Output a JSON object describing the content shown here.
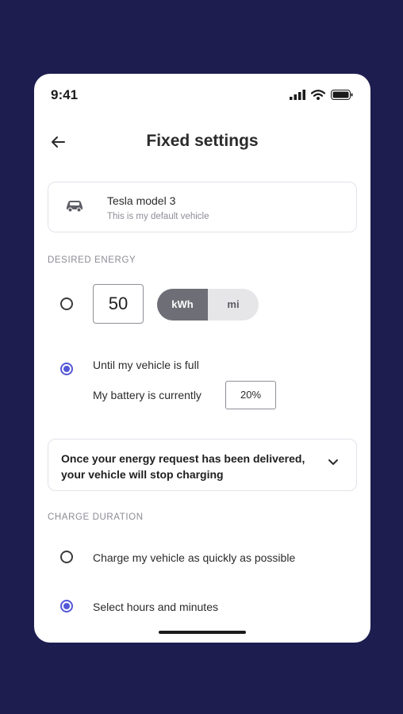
{
  "status_bar": {
    "time": "9:41",
    "icons": [
      "signal-icon",
      "wifi-icon",
      "battery-icon"
    ]
  },
  "header": {
    "title": "Fixed settings",
    "back_icon": "arrow-left-icon"
  },
  "vehicle": {
    "name": "Tesla model 3",
    "subtitle": "This is my default vehicle",
    "icon": "car-icon"
  },
  "desired_energy": {
    "section_label": "DESIRED ENERGY",
    "amount_option": {
      "selected": false,
      "value": "50",
      "units": [
        "kWh",
        "mi"
      ],
      "selected_unit": "kWh"
    },
    "full_option": {
      "selected": true,
      "label": "Until my vehicle is full",
      "battery_label": "My battery is currently",
      "battery_value": "20%"
    }
  },
  "info": {
    "text": "Once your energy request has been delivered, your vehicle will stop charging",
    "icon": "chevron-down-icon"
  },
  "charge_duration": {
    "section_label": "CHARGE DURATION",
    "options": [
      {
        "label": "Charge my vehicle as quickly as possible",
        "selected": false
      },
      {
        "label": "Select hours and minutes",
        "selected": true
      }
    ]
  },
  "colors": {
    "background": "#1e1d50",
    "accent": "#5457d6",
    "toggle_active": "#6e6e77"
  }
}
